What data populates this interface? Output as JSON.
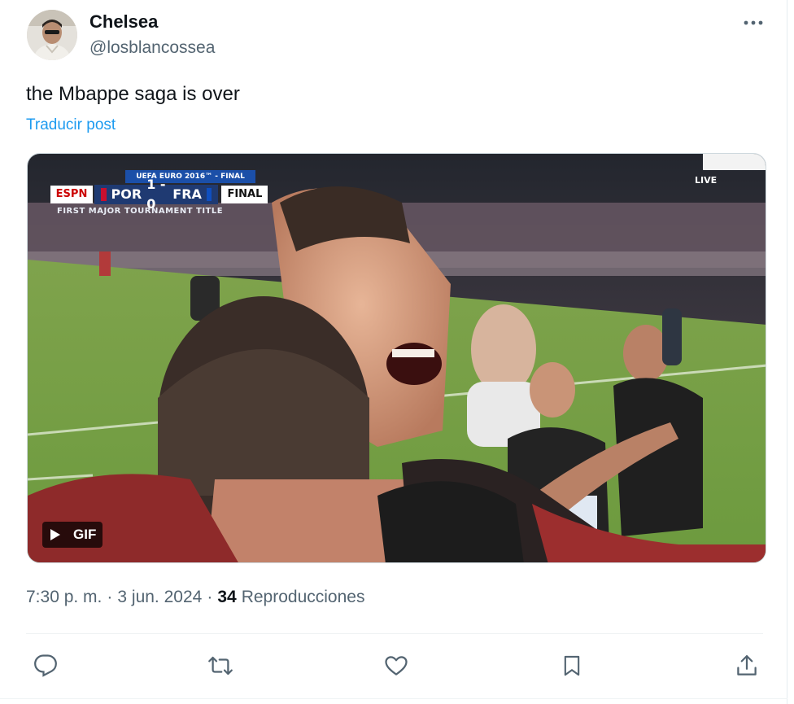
{
  "author": {
    "display_name": "Chelsea",
    "handle": "@losblancossea",
    "avatar_icon": "profile-avatar"
  },
  "tweet": {
    "text": "the Mbappe saga is over",
    "translate_label": "Traducir post"
  },
  "media": {
    "type": "gif",
    "gif_label": "GIF",
    "scoreboard": {
      "title": "UEFA EURO 2016™ - FINAL",
      "broadcaster": "ESPN",
      "home": "POR",
      "score": "1 - 0",
      "away": "FRA",
      "status": "FINAL",
      "subtitle": "FIRST MAJOR TOURNAMENT TITLE",
      "live": "LIVE"
    }
  },
  "meta": {
    "time": "7:30 p. m.",
    "separator": "·",
    "date": "3 jun. 2024",
    "views_count": "34",
    "views_label": "Reproducciones"
  },
  "actions": [
    {
      "name": "reply",
      "icon": "reply-icon"
    },
    {
      "name": "retweet",
      "icon": "retweet-icon"
    },
    {
      "name": "like",
      "icon": "heart-icon"
    },
    {
      "name": "bookmark",
      "icon": "bookmark-icon"
    },
    {
      "name": "share",
      "icon": "share-icon"
    }
  ],
  "colors": {
    "link": "#1d9bf0",
    "secondary_text": "#536471",
    "primary_text": "#0f1419",
    "icon": "#536471"
  }
}
